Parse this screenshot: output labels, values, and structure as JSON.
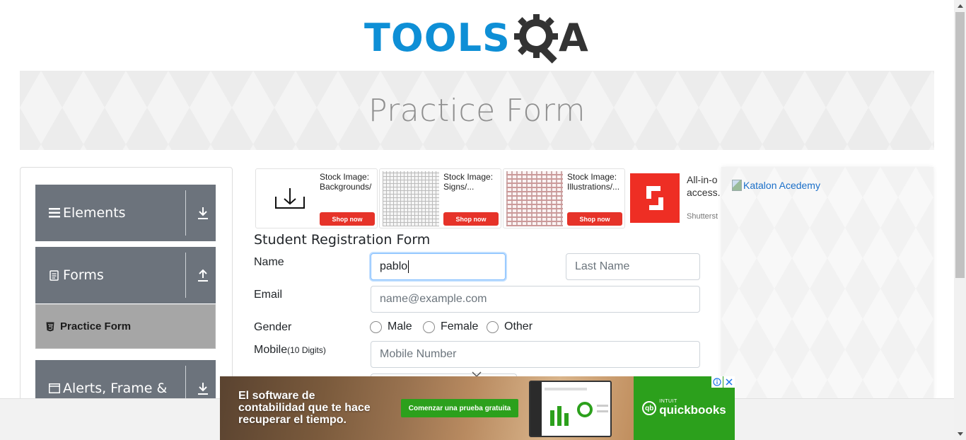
{
  "logo": {
    "part1": "TOOLS",
    "part2": "A"
  },
  "banner": {
    "title": "Practice Form"
  },
  "sidebar": {
    "groups": [
      {
        "label": "Elements",
        "icon": "hamburger-icon",
        "arrow": "download-arrow-icon"
      },
      {
        "label": "Forms",
        "icon": "document-icon",
        "arrow": "upload-arrow-icon"
      },
      {
        "label": "Alerts, Frame &",
        "icon": "window-icon",
        "arrow": "download-arrow-icon"
      }
    ],
    "active_item": {
      "label": "Practice Form",
      "icon": "html5-shield-icon"
    }
  },
  "ads": {
    "cards": [
      {
        "line1": "Stock Image:",
        "line2": "Backgrounds/",
        "button": "Shop now"
      },
      {
        "line1": "Stock Image:",
        "line2": "Signs/...",
        "button": "Shop now"
      },
      {
        "line1": "Stock Image:",
        "line2": "Illustrations/...",
        "button": "Shop now"
      }
    ],
    "shutter_text_1": "All-in-o",
    "shutter_text_2": "access.",
    "shutter_brand": "Shutterst"
  },
  "form": {
    "title": "Student Registration Form",
    "name_label": "Name",
    "first_name_value": "pablo",
    "last_name_placeholder": "Last Name",
    "email_label": "Email",
    "email_placeholder": "name@example.com",
    "gender_label": "Gender",
    "gender_options": [
      "Male",
      "Female",
      "Other"
    ],
    "mobile_label": "Mobile",
    "mobile_hint": "(10 Digits)",
    "mobile_placeholder": "Mobile Number"
  },
  "right_ad": {
    "alt_text": "Katalon Acedemy"
  },
  "bottom_ad": {
    "line1": "El software de",
    "line2": "contabilidad que te hace",
    "line3": "recuperar el tiempo.",
    "cta": "Comenzar una prueba gratuita",
    "brand_intuit": "INTUIT",
    "brand_name": "quickbooks",
    "brand_mark": "qb"
  },
  "colors": {
    "brand_blue": "#0e8fd6",
    "sidebar_gray": "#6c737c",
    "ad_red": "#e63329",
    "qb_green": "#2ca01c"
  }
}
